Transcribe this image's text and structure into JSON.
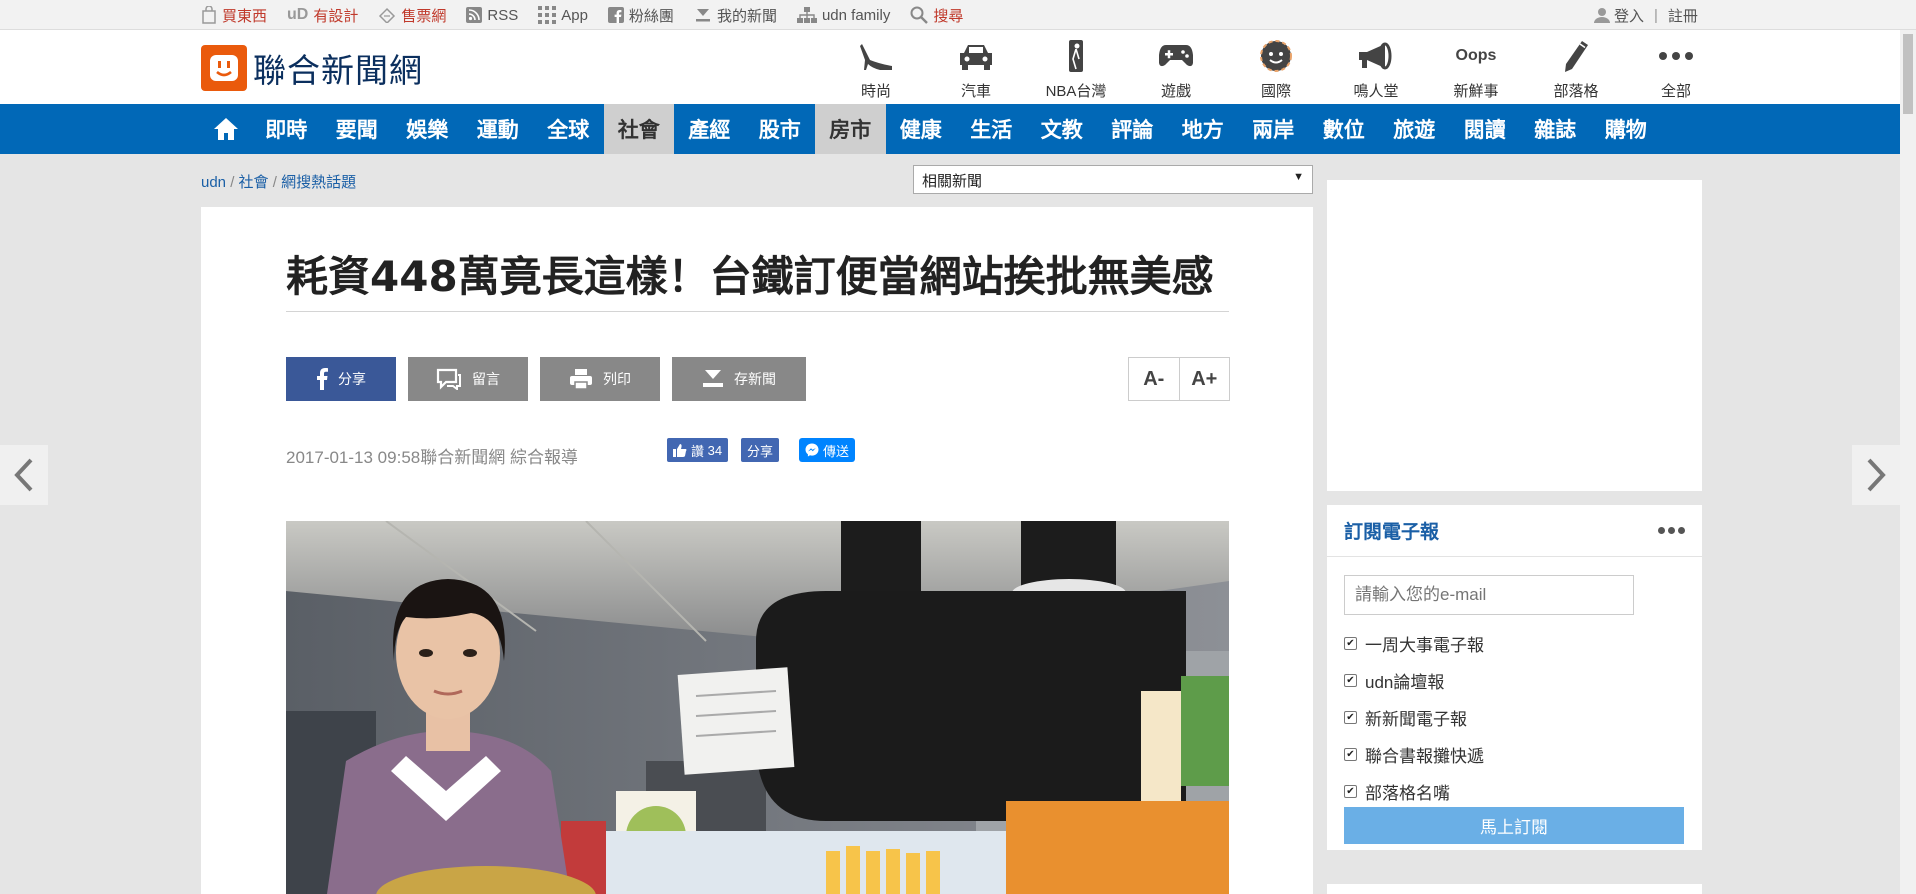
{
  "topbar": {
    "links": [
      {
        "label": "買東西",
        "icon": "shopping-bag-icon",
        "color": "#c0392b"
      },
      {
        "label": "有設計",
        "icon": "ud-logo-icon",
        "color": "#c0392b"
      },
      {
        "label": "售票網",
        "icon": "ticket-icon",
        "color": "#c0392b"
      },
      {
        "label": "RSS",
        "icon": "rss-icon",
        "color": "#555555"
      },
      {
        "label": "App",
        "icon": "app-grid-icon",
        "color": "#555555"
      },
      {
        "label": "粉絲團",
        "icon": "facebook-icon",
        "color": "#555555"
      },
      {
        "label": "我的新聞",
        "icon": "download-icon",
        "color": "#555555"
      },
      {
        "label": "udn family",
        "icon": "sitemap-icon",
        "color": "#555555"
      },
      {
        "label": "搜尋",
        "icon": "search-icon",
        "color": "#c0392b"
      }
    ],
    "login": "登入",
    "register": "註冊"
  },
  "header": {
    "logo_text": "聯合新聞網",
    "logo_color": "#ea5a0c",
    "channels": [
      {
        "label": "時尚",
        "icon": "high-heel-icon"
      },
      {
        "label": "汽車",
        "icon": "car-icon"
      },
      {
        "label": "NBA台灣",
        "icon": "nba-logo-icon"
      },
      {
        "label": "遊戲",
        "icon": "gamepad-icon"
      },
      {
        "label": "國際",
        "icon": "globe-face-icon"
      },
      {
        "label": "鳴人堂",
        "icon": "megaphone-icon"
      },
      {
        "label": "新鮮事",
        "icon": "oops-icon",
        "icon_text": "Oops"
      },
      {
        "label": "部落格",
        "icon": "pencil-icon"
      },
      {
        "label": "全部",
        "icon": "more-dots-icon"
      }
    ]
  },
  "nav": {
    "color": "#0168b7",
    "items": [
      "即時",
      "要聞",
      "娛樂",
      "運動",
      "全球",
      "社會",
      "產經",
      "股市",
      "房市",
      "健康",
      "生活",
      "文教",
      "評論",
      "地方",
      "兩岸",
      "數位",
      "旅遊",
      "閱讀",
      "雜誌",
      "購物"
    ],
    "highlighted": [
      "社會",
      "房市"
    ]
  },
  "breadcrumb": {
    "items": [
      "udn",
      "社會",
      "網搜熱話題"
    ],
    "separator": "/"
  },
  "related_select": {
    "value": "相關新聞"
  },
  "article": {
    "title": "耗資448萬竟長這樣！台鐵訂便當網站挨批無美感",
    "buttons": {
      "share": "分享",
      "comment": "留言",
      "print": "列印",
      "save": "存新聞"
    },
    "font_smaller": "A-",
    "font_larger": "A+",
    "meta": {
      "datetime": "2017-01-13 09:58",
      "source": "聯合新聞網 綜合報導"
    },
    "social": {
      "like_label": "讚",
      "like_count": "34",
      "share": "分享",
      "send": "傳送"
    }
  },
  "subscription": {
    "title": "訂閱電子報",
    "email_placeholder": "請輸入您的e-mail",
    "options": [
      "一周大事電子報",
      "udn論壇報",
      "新新聞電子報",
      "聯合書報攤快遞",
      "部落格名嘴"
    ],
    "submit": "馬上訂閱",
    "button_color": "#6aafe6"
  }
}
